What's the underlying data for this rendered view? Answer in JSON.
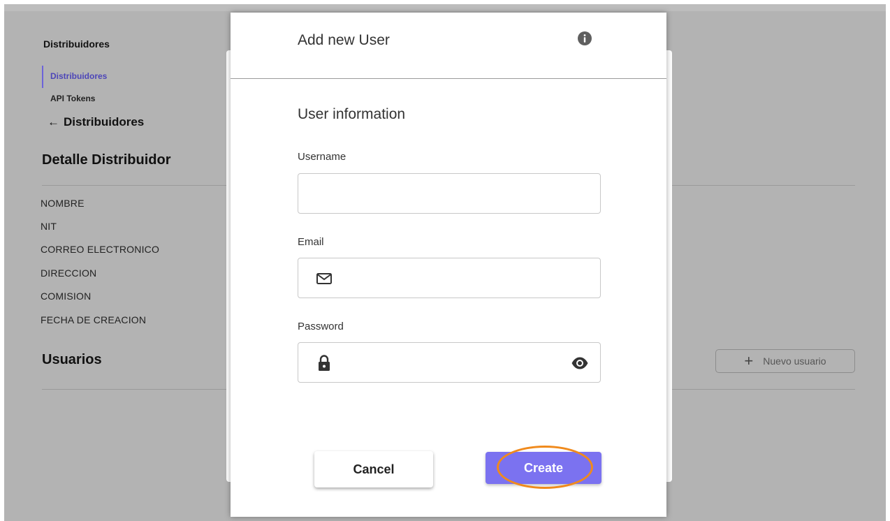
{
  "background": {
    "sidebar_title": "Distribuidores",
    "nav_items": [
      "Distribuidores",
      "API Tokens"
    ],
    "back_link": "Distribuidores",
    "back_arrow": "←",
    "detail_title": "Detalle Distribuidor",
    "fields": [
      "NOMBRE",
      "NIT",
      "CORREO ELECTRONICO",
      "DIRECCION",
      "COMISION",
      "FECHA DE CREACION"
    ],
    "users_title": "Usuarios",
    "new_user_button": "Nuevo usuario",
    "new_user_icon": "plus-icon",
    "accent_color": "#6c63d9"
  },
  "modal": {
    "title": "Add new User",
    "info_icon": "info-icon",
    "section_title": "User information",
    "username": {
      "label": "Username",
      "value": ""
    },
    "email": {
      "label": "Email",
      "value": "",
      "icon": "mail-icon"
    },
    "password": {
      "label": "Password",
      "value": "",
      "icon": "lock-icon",
      "toggle_icon": "eye-icon"
    },
    "cancel_label": "Cancel",
    "create_label": "Create",
    "create_color": "#7b72f0",
    "highlight_color": "#f08a1c"
  }
}
